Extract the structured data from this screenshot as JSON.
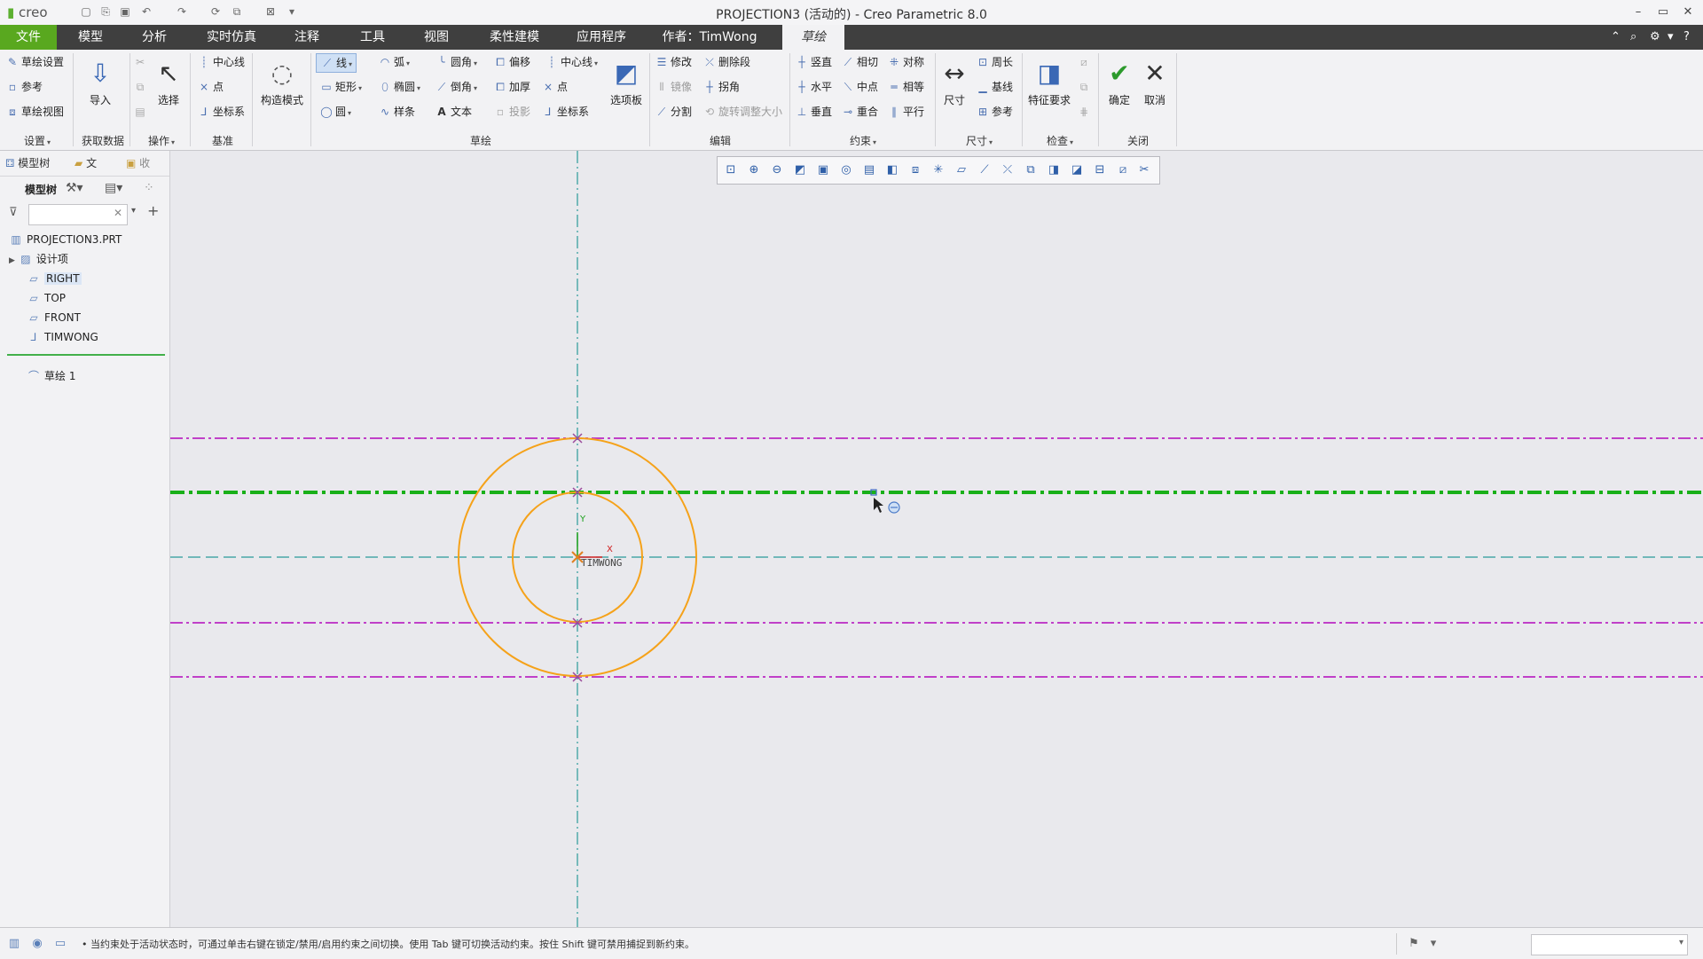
{
  "app": {
    "logo": "creo",
    "window_title": "PROJECTION3 (活动的) - Creo Parametric 8.0"
  },
  "menu": {
    "items": [
      "文件",
      "模型",
      "分析",
      "实时仿真",
      "注释",
      "工具",
      "视图",
      "柔性建模",
      "应用程序",
      "作者：TimWong",
      "草绘"
    ]
  },
  "ribbon": {
    "setup": {
      "sketch_setup": "草绘设置",
      "reference": "参考",
      "sketch_view": "草绘视图",
      "group": "设置"
    },
    "get_data": {
      "import": "导入",
      "group": "获取数据"
    },
    "operations": {
      "select": "选择",
      "group": "操作"
    },
    "datum": {
      "centerline": "中心线",
      "point": "点",
      "coord_sys": "坐标系",
      "group": "基准"
    },
    "construction_mode": "构造模式",
    "sketch": {
      "line": "线",
      "arc": "弧",
      "fillet": "圆角",
      "offset": "偏移",
      "centerline": "中心线",
      "rectangle": "矩形",
      "ellipse": "椭圆",
      "chamfer": "倒角",
      "thicken": "加厚",
      "point": "点",
      "circle": "圆",
      "spline": "样条",
      "text": "文本",
      "project": "投影",
      "coord_sys": "坐标系",
      "palette": "选项板",
      "group": "草绘"
    },
    "edit": {
      "modify": "修改",
      "delete_segment": "删除段",
      "mirror": "镜像",
      "corner": "拐角",
      "divide": "分割",
      "rotate_resize": "旋转调整大小",
      "group": "编辑"
    },
    "constrain": {
      "vertical": "竖直",
      "tangent": "相切",
      "symmetric": "对称",
      "horizontal": "水平",
      "midpoint": "中点",
      "equal": "相等",
      "perpendicular": "垂直",
      "coincident": "重合",
      "parallel": "平行",
      "group": "约束"
    },
    "dimension": {
      "dimension": "尺寸",
      "perimeter": "周长",
      "baseline": "基线",
      "reference": "参考",
      "group": "尺寸"
    },
    "inspect": {
      "feature_req": "特征要求",
      "group": "检查"
    },
    "close": {
      "ok": "确定",
      "cancel": "取消",
      "group": "关闭"
    }
  },
  "left_panel": {
    "tabs": [
      "模型树",
      "文",
      "收"
    ],
    "toolbar_label": "模型树",
    "search_placeholder": "",
    "tree": [
      {
        "label": "PROJECTION3.PRT",
        "icon": "part-icon"
      },
      {
        "label": "设计项",
        "icon": "design-items-icon"
      },
      {
        "label": "RIGHT",
        "icon": "datum-plane-icon"
      },
      {
        "label": "TOP",
        "icon": "datum-plane-icon"
      },
      {
        "label": "FRONT",
        "icon": "datum-plane-icon"
      },
      {
        "label": "TIMWONG",
        "icon": "coord-sys-icon"
      },
      {
        "label": "草绘 1",
        "icon": "sketch-icon"
      }
    ]
  },
  "canvas": {
    "coord_label": "TIMWONG",
    "axis_x": "X",
    "axis_y": "Y",
    "colors": {
      "circle": "#f5a21a",
      "ref_line": "#c040c8",
      "active_line": "#19b019",
      "centerline": "#2a9a9a"
    }
  },
  "status": {
    "message": "• 当约束处于活动状态时，可通过单击右键在锁定/禁用/启用约束之间切换。使用 Tab 键可切换活动约束。按住 Shift 键可禁用捕捉到新约束。"
  }
}
